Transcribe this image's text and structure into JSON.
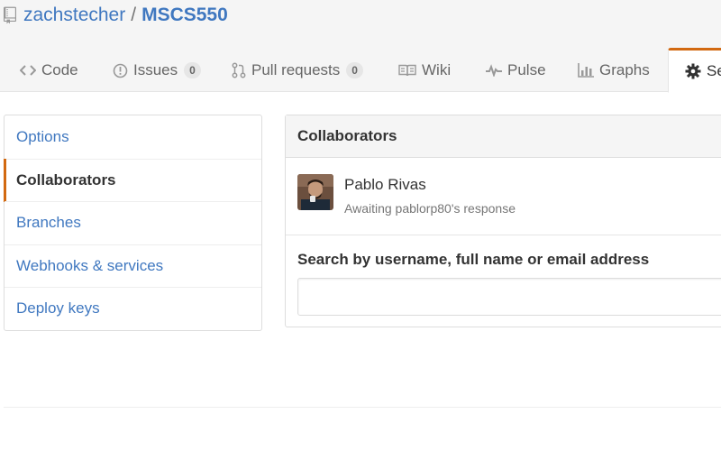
{
  "repo": {
    "owner": "zachstecher",
    "separator": "/",
    "name": "MSCS550",
    "icon": "repo-icon"
  },
  "tabs": [
    {
      "label": "Code",
      "icon": "code-icon"
    },
    {
      "label": "Issues",
      "icon": "issue-icon",
      "count": "0"
    },
    {
      "label": "Pull requests",
      "icon": "pull-request-icon",
      "count": "0"
    },
    {
      "label": "Wiki",
      "icon": "book-icon"
    },
    {
      "label": "Pulse",
      "icon": "pulse-icon"
    },
    {
      "label": "Graphs",
      "icon": "graph-icon"
    },
    {
      "label": "Se",
      "icon": "gear-icon",
      "selected": true
    }
  ],
  "settings_menu": {
    "items": [
      {
        "label": "Options"
      },
      {
        "label": "Collaborators",
        "selected": true
      },
      {
        "label": "Branches"
      },
      {
        "label": "Webhooks & services"
      },
      {
        "label": "Deploy keys"
      }
    ]
  },
  "collaborators": {
    "header": "Collaborators",
    "people": [
      {
        "name": "Pablo Rivas",
        "status": "Awaiting pablorp80's response"
      }
    ],
    "search_label": "Search by username, full name or email address",
    "search_value": ""
  },
  "colors": {
    "accent": "#d26911",
    "link": "#4078c0",
    "header_bg": "#f5f5f5"
  }
}
